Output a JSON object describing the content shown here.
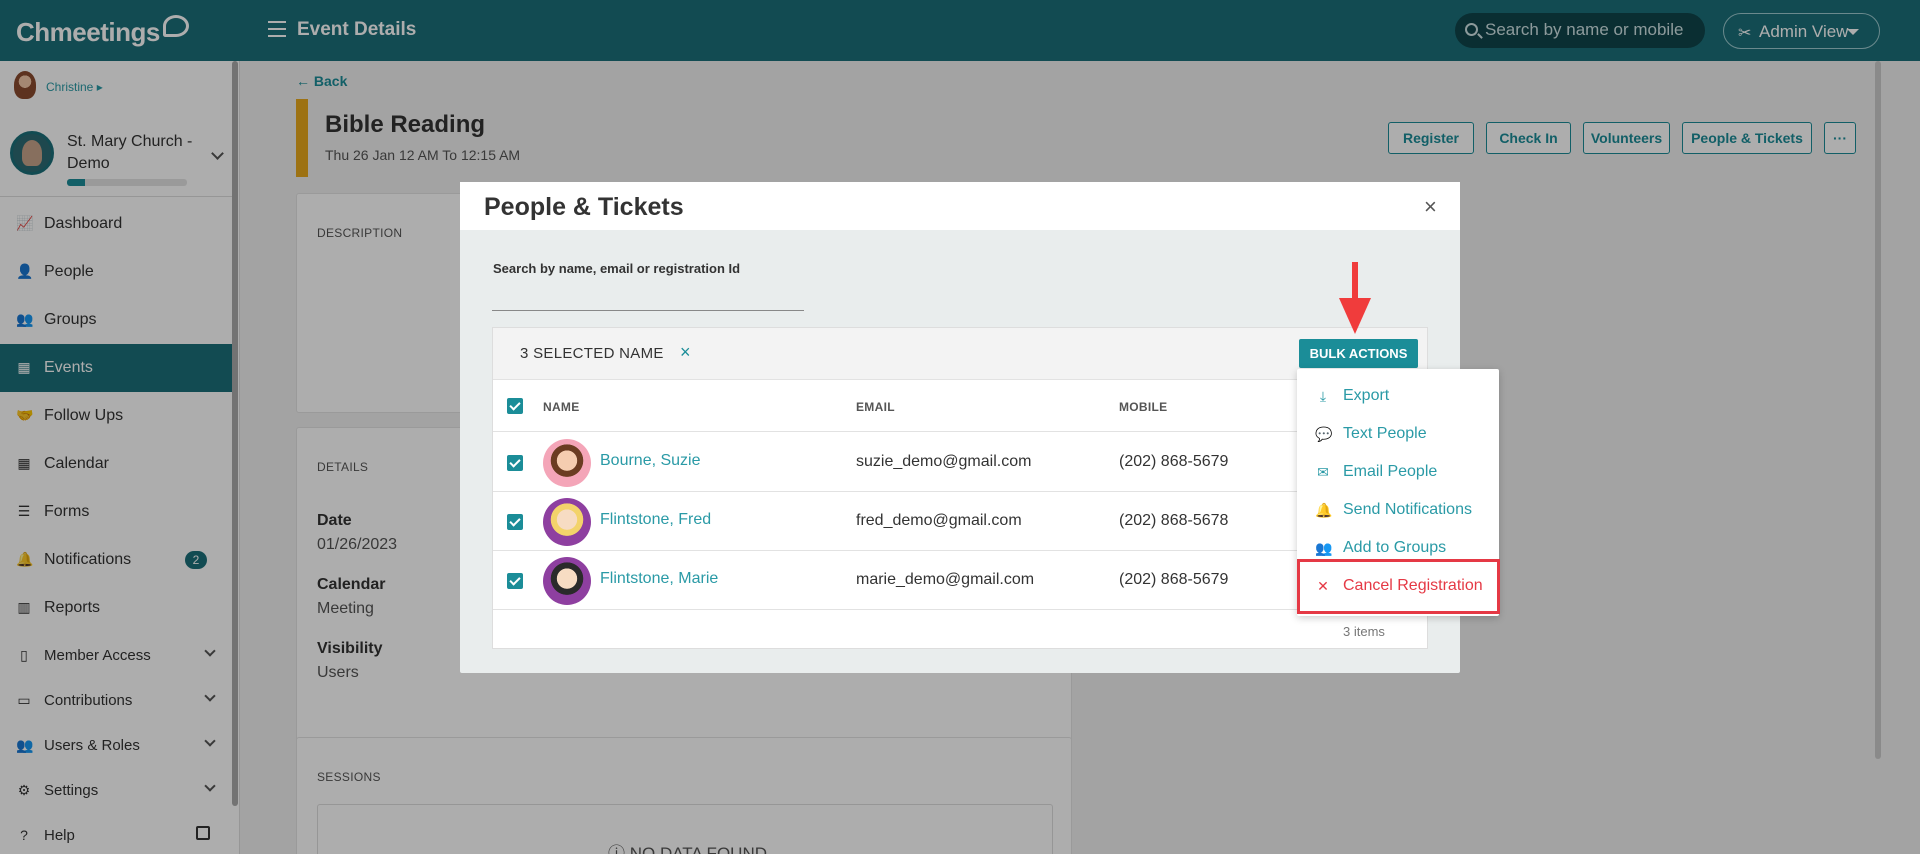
{
  "topbar": {
    "logo": "Chmeetings",
    "page_title": "Event Details",
    "search_placeholder": "Search by name or mobile",
    "admin_view_label": "Admin View"
  },
  "sidebar": {
    "user_name": "Christine",
    "church_name": "St. Mary Church - Demo",
    "progress_fraction": 0.15,
    "items": [
      {
        "label": "Dashboard",
        "icon": "chart-line-icon"
      },
      {
        "label": "People",
        "icon": "user-icon"
      },
      {
        "label": "Groups",
        "icon": "users-icon"
      },
      {
        "label": "Events",
        "icon": "calendar-icon",
        "active": true
      },
      {
        "label": "Follow Ups",
        "icon": "handshake-icon"
      },
      {
        "label": "Calendar",
        "icon": "calendar-grid-icon"
      },
      {
        "label": "Forms",
        "icon": "list-icon"
      },
      {
        "label": "Notifications",
        "icon": "bell-icon",
        "badge": "2"
      },
      {
        "label": "Reports",
        "icon": "bar-chart-icon"
      },
      {
        "label": "Member Access",
        "icon": "mobile-icon"
      },
      {
        "label": "Contributions",
        "icon": "money-icon"
      },
      {
        "label": "Users & Roles",
        "icon": "users-cog-icon"
      },
      {
        "label": "Settings",
        "icon": "gear-icon"
      },
      {
        "label": "Help",
        "icon": "question-icon"
      }
    ]
  },
  "event": {
    "back_label": "Back",
    "title": "Bible Reading",
    "date_line": "Thu 26 Jan  12 AM To 12:15 AM",
    "buttons": [
      "Register",
      "Check In",
      "Volunteers",
      "People & Tickets",
      "···"
    ],
    "description_label": "DESCRIPTION",
    "details_label": "DETAILS",
    "date_key": "Date",
    "date_value": "01/26/2023",
    "calendar_key": "Calendar",
    "calendar_value": "Meeting",
    "visibility_key": "Visibility",
    "visibility_value": "Users",
    "sessions_label": "SESSIONS",
    "no_data": "NO DATA FOUND"
  },
  "modal": {
    "title": "People & Tickets",
    "close": "×",
    "search_label": "Search by name, email or registration Id",
    "selected_text": "3 SELECTED NAME",
    "clear_icon": "×",
    "bulk_actions_label": "BULK ACTIONS",
    "columns": {
      "name": "NAME",
      "email": "EMAIL",
      "mobile": "MOBILE"
    },
    "rows": [
      {
        "name": "Bourne, Suzie",
        "email": "suzie_demo@gmail.com",
        "mobile": "(202) 868-5679"
      },
      {
        "name": "Flintstone, Fred",
        "email": "fred_demo@gmail.com",
        "mobile": "(202) 868-5678"
      },
      {
        "name": "Flintstone, Marie",
        "email": "marie_demo@gmail.com",
        "mobile": "(202) 868-5679"
      }
    ],
    "items_count": "3 items"
  },
  "bulk_menu": {
    "items": [
      {
        "label": "Export",
        "icon": "download-icon"
      },
      {
        "label": "Text People",
        "icon": "message-icon"
      },
      {
        "label": "Email People",
        "icon": "envelope-icon"
      },
      {
        "label": "Send Notifications",
        "icon": "bell-icon"
      },
      {
        "label": "Add to Groups",
        "icon": "users-icon"
      },
      {
        "label": "Cancel Registration",
        "icon": "close-icon"
      }
    ]
  },
  "colors": {
    "brand": "#1b6f79",
    "accent": "#1b8d98",
    "danger": "#e53945",
    "event_bar": "#e8a81c"
  }
}
